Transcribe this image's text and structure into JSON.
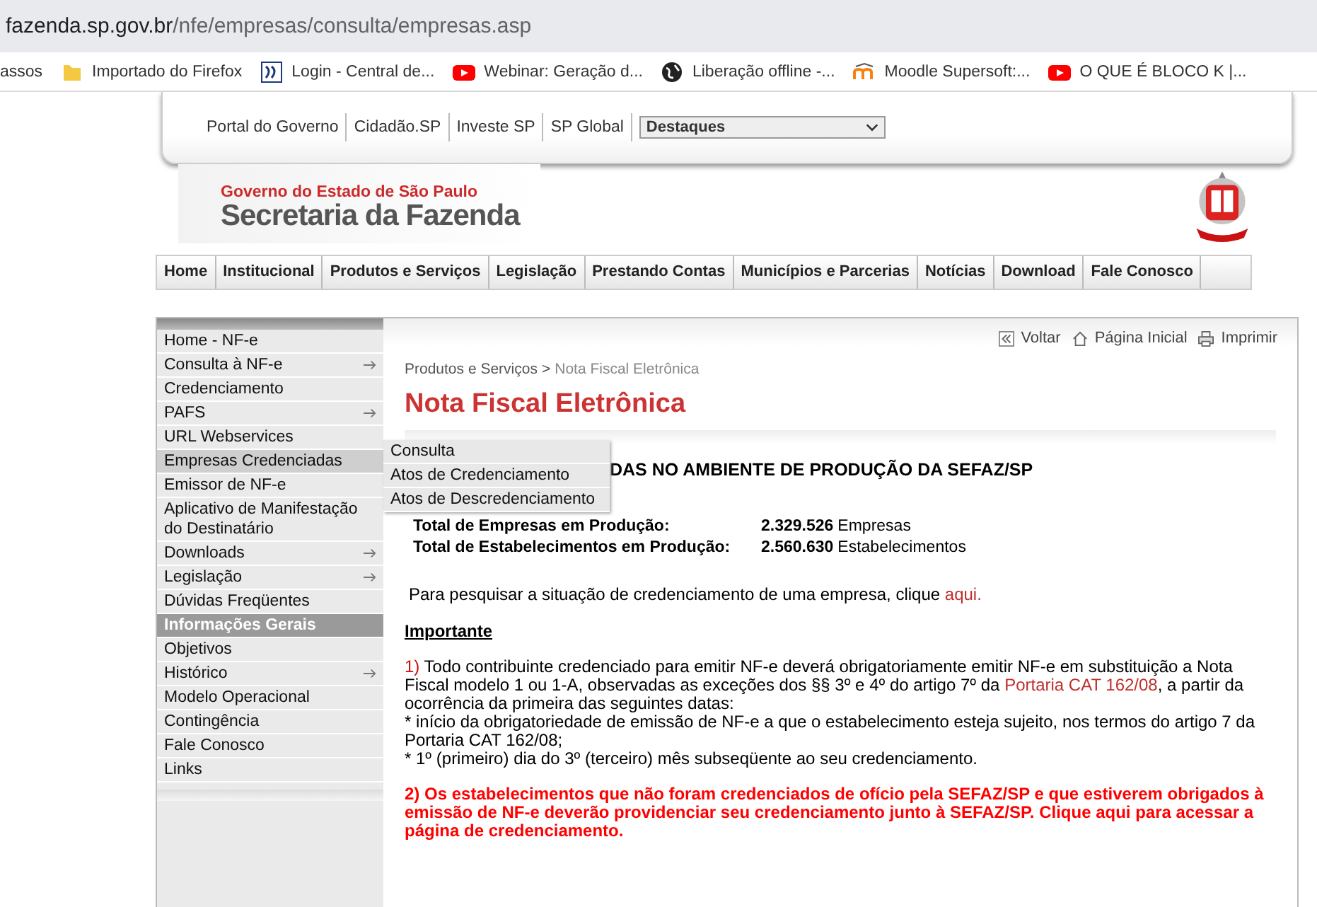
{
  "browser": {
    "url_host": "fazenda.sp.gov.br",
    "url_path": "/nfe/empresas/consulta/empresas.asp",
    "bookmarks": [
      {
        "label": "assos",
        "kind": "none"
      },
      {
        "label": "Importado do Firefox",
        "kind": "folder"
      },
      {
        "label": "Login - Central de...",
        "kind": "ss"
      },
      {
        "label": "Webinar: Geração d...",
        "kind": "video"
      },
      {
        "label": "Liberação offline -...",
        "kind": "globe"
      },
      {
        "label": "Moodle Supersoft:...",
        "kind": "moodle"
      },
      {
        "label": "O QUE É BLOCO K |...",
        "kind": "video"
      }
    ]
  },
  "top_links": [
    "Portal do Governo",
    "Cidadão.SP",
    "Investe SP",
    "SP Global"
  ],
  "highlights_select": {
    "value": "Destaques"
  },
  "header": {
    "government": "Governo do Estado de São Paulo",
    "secretariat": "Secretaria da Fazenda"
  },
  "main_nav": [
    "Home",
    "Institucional",
    "Produtos e Serviços",
    "Legislação",
    "Prestando Contas",
    "Municípios e Parcerias",
    "Notícias",
    "Download",
    "Fale Conosco"
  ],
  "sidebar": {
    "items": [
      {
        "label": "Home - NF-e",
        "kind": "item",
        "submenu": false,
        "selected": false
      },
      {
        "label": "Consulta à NF-e",
        "kind": "item",
        "submenu": true,
        "selected": false
      },
      {
        "label": "Credenciamento",
        "kind": "item",
        "submenu": false,
        "selected": false
      },
      {
        "label": "PAFS",
        "kind": "item",
        "submenu": true,
        "selected": false
      },
      {
        "label": "URL Webservices",
        "kind": "item",
        "submenu": false,
        "selected": false
      },
      {
        "label": "Empresas Credenciadas",
        "kind": "item",
        "submenu": false,
        "selected": true
      },
      {
        "label": "Emissor de NF-e",
        "kind": "item",
        "submenu": false,
        "selected": false
      },
      {
        "label": "Aplicativo de Manifestação do Destinatário",
        "kind": "item",
        "submenu": false,
        "selected": false
      },
      {
        "label": "Downloads",
        "kind": "item",
        "submenu": true,
        "selected": false
      },
      {
        "label": "Legislação",
        "kind": "item",
        "submenu": true,
        "selected": false
      },
      {
        "label": "Dúvidas Freqüentes",
        "kind": "item",
        "submenu": false,
        "selected": false
      },
      {
        "label": "Informações Gerais",
        "kind": "section",
        "submenu": false
      },
      {
        "label": "Objetivos",
        "kind": "item",
        "submenu": false,
        "selected": false
      },
      {
        "label": "Histórico",
        "kind": "item",
        "submenu": true,
        "selected": false
      },
      {
        "label": "Modelo Operacional",
        "kind": "item",
        "submenu": false,
        "selected": false
      },
      {
        "label": "Contingência",
        "kind": "item",
        "submenu": false,
        "selected": false
      },
      {
        "label": "Fale Conosco",
        "kind": "item",
        "submenu": false,
        "selected": false
      },
      {
        "label": "Links",
        "kind": "item",
        "submenu": false,
        "selected": false
      }
    ]
  },
  "submenu": [
    "Consulta",
    "Atos de Credenciamento",
    "Atos de Descredenciamento"
  ],
  "toolbar": [
    {
      "label": "Voltar",
      "kind": "back"
    },
    {
      "label": "Página Inicial",
      "kind": "home"
    },
    {
      "label": "Imprimir",
      "kind": "print"
    }
  ],
  "breadcrumb": {
    "parent": "Produtos e Serviços",
    "separator": ">",
    "current": "Nota Fiscal Eletrônica"
  },
  "title": "Nota Fiscal Eletrônica",
  "section_heading": "DAS NO AMBIENTE DE PRODUÇÃO DA SEFAZ/SP",
  "stats": [
    {
      "label": "Total de Empresas em Produção:",
      "value": "2.329.526",
      "unit": "Empresas"
    },
    {
      "label": "Total de Estabelecimentos em Produção:",
      "value": "2.560.630",
      "unit": "Estabelecimentos"
    }
  ],
  "search_line": {
    "text": "Para pesquisar a situação de credenciamento de uma empresa, clique ",
    "link": "aqui."
  },
  "important": {
    "heading": "Importante",
    "item_1": {
      "number": "1)",
      "before": " Todo contribuinte credenciado para emitir NF-e deverá obrigatoriamente emitir NF-e em substituição a Nota Fiscal modelo 1 ou 1-A, observadas as exceções dos §§ 3º e 4º do artigo 7º da ",
      "link": "Portaria CAT 162/08",
      "after": ", a partir da ocorrência da primeira das seguintes datas:",
      "lines": [
        "* início da obrigatoriedade de emissão de NF-e a que o estabelecimento esteja sujeito, nos termos do artigo 7 da Portaria CAT 162/08;",
        "* 1º (primeiro) dia do 3º (terceiro) mês subseqüente ao seu credenciamento."
      ]
    },
    "item_2": "2) Os estabelecimentos que não foram credenciados de ofício pela SEFAZ/SP e que estiverem obrigados à emissão de NF-e deverão providenciar seu credenciamento junto à SEFAZ/SP. Clique aqui para acessar a página de credenciamento."
  }
}
